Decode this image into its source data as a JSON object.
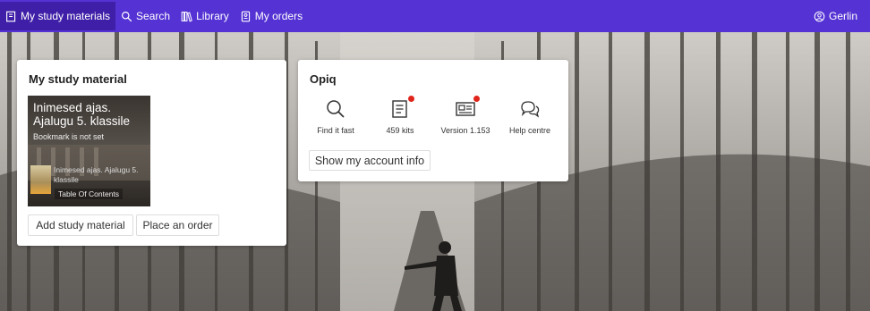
{
  "nav": {
    "items": [
      {
        "label": "My study materials",
        "icon": "book-icon",
        "active": true
      },
      {
        "label": "Search",
        "icon": "search-icon"
      },
      {
        "label": "Library",
        "icon": "library-icon"
      },
      {
        "label": "My orders",
        "icon": "orders-icon"
      }
    ],
    "user": {
      "label": "Gerlin",
      "icon": "user-icon"
    }
  },
  "my_study": {
    "title": "My study material",
    "book": {
      "title": "Inimesed ajas. Ajalugu 5. klassile",
      "bookmark": "Bookmark is not set",
      "small_title": "Inimesed ajas. Ajalugu 5. klassile",
      "toc": "Table Of Contents"
    },
    "add_button": "Add study material",
    "order_button": "Place an order"
  },
  "opiq": {
    "title": "Opiq",
    "tools": [
      {
        "label": "Find it fast",
        "icon": "search-icon",
        "badge": false
      },
      {
        "label": "459 kits",
        "icon": "kits-icon",
        "badge": true
      },
      {
        "label": "Version 1.153",
        "icon": "news-icon",
        "badge": true
      },
      {
        "label": "Help centre",
        "icon": "chat-icon",
        "badge": false
      }
    ],
    "account_button": "Show my account info"
  },
  "colors": {
    "nav": "#5432d3",
    "nav_active": "#3f1fa8",
    "badge": "#e0241b"
  }
}
